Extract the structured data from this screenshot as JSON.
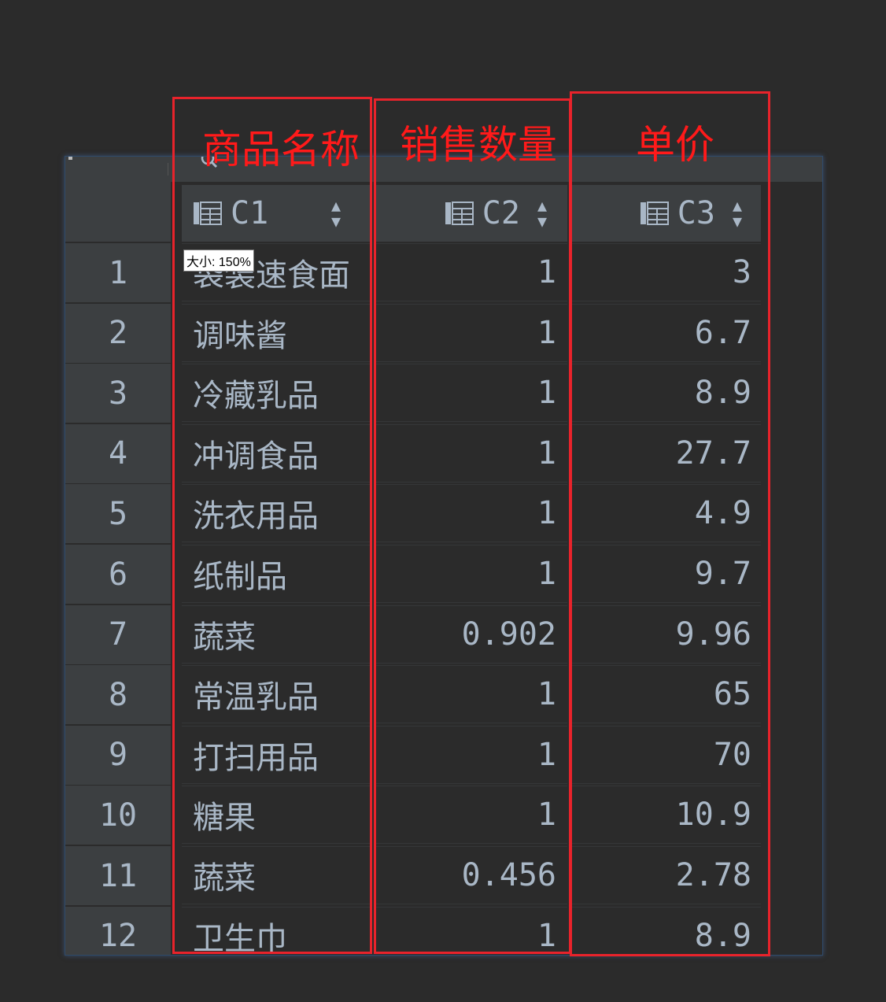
{
  "annotations": {
    "c1_label": "商品名称",
    "c2_label": "销售数量",
    "c3_label": "单价",
    "color": "#e8232b"
  },
  "tooltip": "大小: 150%",
  "columns": [
    {
      "name": "C1",
      "icon": "table-column-icon"
    },
    {
      "name": "C2",
      "icon": "table-column-icon"
    },
    {
      "name": "C3",
      "icon": "table-column-icon"
    }
  ],
  "rows": [
    {
      "num": "1",
      "c1": "袋装速食面",
      "c2": "1",
      "c3": "3"
    },
    {
      "num": "2",
      "c1": "调味酱",
      "c2": "1",
      "c3": "6.7"
    },
    {
      "num": "3",
      "c1": "冷藏乳品",
      "c2": "1",
      "c3": "8.9"
    },
    {
      "num": "4",
      "c1": "冲调食品",
      "c2": "1",
      "c3": "27.7"
    },
    {
      "num": "5",
      "c1": "洗衣用品",
      "c2": "1",
      "c3": "4.9"
    },
    {
      "num": "6",
      "c1": "纸制品",
      "c2": "1",
      "c3": "9.7"
    },
    {
      "num": "7",
      "c1": "蔬菜",
      "c2": "0.902",
      "c3": "9.96"
    },
    {
      "num": "8",
      "c1": "常温乳品",
      "c2": "1",
      "c3": "65"
    },
    {
      "num": "9",
      "c1": "打扫用品",
      "c2": "1",
      "c3": "70"
    },
    {
      "num": "10",
      "c1": "糖果",
      "c2": "1",
      "c3": "10.9"
    },
    {
      "num": "11",
      "c1": "蔬菜",
      "c2": "0.456",
      "c3": "2.78"
    },
    {
      "num": "12",
      "c1": "卫生巾",
      "c2": "1",
      "c3": "8.9"
    }
  ],
  "colors": {
    "background": "#2b2b2b",
    "header": "#3c3f41",
    "text": "#a9b7c6",
    "panel_border": "#2f4a6a"
  }
}
